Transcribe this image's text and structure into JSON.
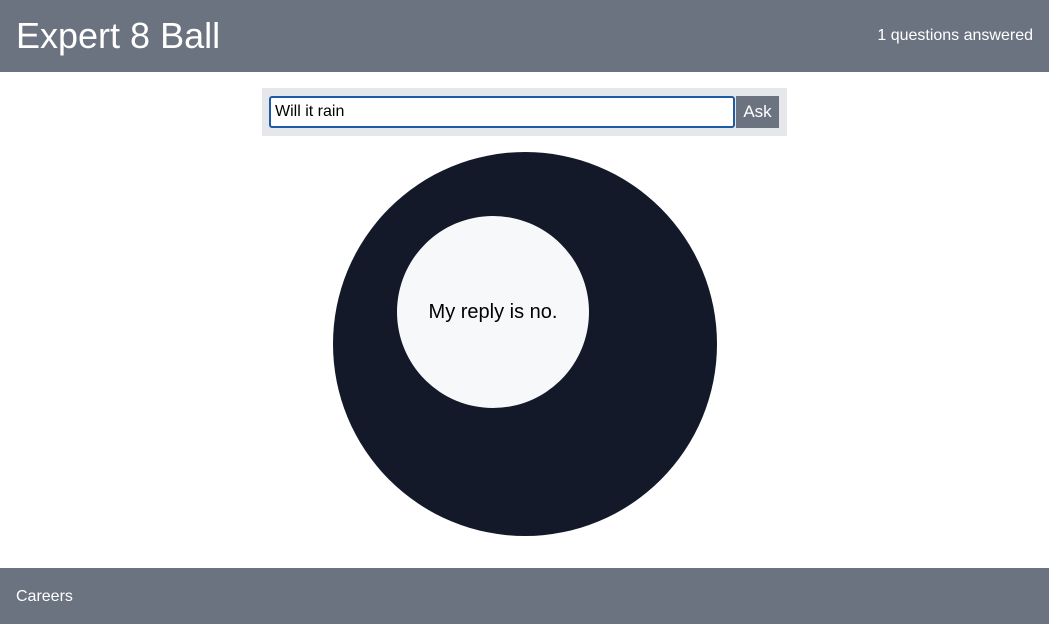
{
  "header": {
    "title": "Expert 8 Ball",
    "counter": "1 questions answered"
  },
  "form": {
    "question_value": "Will it rain",
    "ask_label": "Ask"
  },
  "ball": {
    "answer": "My reply is no."
  },
  "footer": {
    "link_label": "Careers"
  },
  "colors": {
    "bar": "#6b7280",
    "ball": "#131928",
    "window": "#f7f8fa",
    "input_border": "#1e5aa8"
  }
}
